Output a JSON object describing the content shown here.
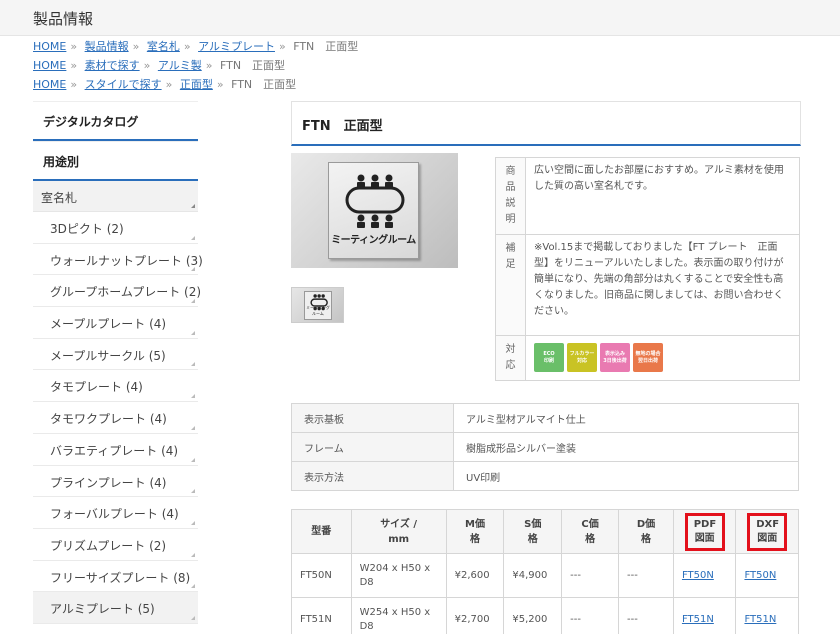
{
  "header": {
    "title": "製品情報"
  },
  "breadcrumbs": [
    {
      "links": [
        "HOME",
        "製品情報",
        "室名札",
        "アルミプレート"
      ],
      "current": "FTN　正面型"
    },
    {
      "links": [
        "HOME",
        "素材で探す",
        "アルミ製"
      ],
      "current": "FTN　正面型"
    },
    {
      "links": [
        "HOME",
        "スタイルで探す",
        "正面型"
      ],
      "current": "FTN　正面型"
    }
  ],
  "sidebar": {
    "catalog": "デジタルカタログ",
    "usage": "用途別",
    "category": "室名札",
    "items": [
      "3Dピクト (2)",
      "ウォールナットプレート (3)",
      "グループホームプレート (2)",
      "メープルプレート (4)",
      "メープルサークル (5)",
      "タモプレート (4)",
      "タモワクプレート (4)",
      "バラエティプレート (4)",
      "プラインプレート (4)",
      "フォーバルプレート (4)",
      "プリズムプレート (2)",
      "フリーサイズプレート (8)",
      "アルミプレート (5)"
    ]
  },
  "product": {
    "title": "FTN　正面型",
    "image_label": "ミーティングルーム",
    "description": {
      "k1": "商品説明",
      "v1": "広い空間に面したお部屋におすすめ。アルミ素材を使用した質の高い室名札です。",
      "k2": "補足",
      "v2": "※Vol.15まで掲載しておりました【FT プレート　正面型】をリニューアルいたしました。表示面の取り付けが簡単になり、先端の角部分は丸くすることで安全性も高くなりました。旧商品に関しましては、お問い合わせください。",
      "k3": "対応",
      "badges": [
        {
          "l1": "ECO",
          "l2": "印刷",
          "color": "#6abf69"
        },
        {
          "l1": "フルカラー",
          "l2": "対応",
          "color": "#c9c324"
        },
        {
          "l1": "表示込み",
          "l2": "3日後出荷",
          "color": "#e97ab1"
        },
        {
          "l1": "無地の場合",
          "l2": "翌日出荷",
          "color": "#e9784a"
        }
      ]
    },
    "specs": [
      {
        "k": "表示基板",
        "v": "アルミ型材アルマイト仕上"
      },
      {
        "k": "フレーム",
        "v": "樹脂成形品シルバー塗装"
      },
      {
        "k": "表示方法",
        "v": "UV印刷"
      }
    ],
    "price_table": {
      "headers": [
        "型番",
        "サイズ / mm",
        "M価格",
        "S価格",
        "C価格",
        "D価格",
        "PDF図面",
        "DXF図面"
      ],
      "rows": [
        {
          "model": "FT50N",
          "size": "W204 x H50 x D8",
          "m": "¥2,600",
          "s": "¥4,900",
          "c": "---",
          "d": "---",
          "pdf": "FT50N",
          "dxf": "FT50N"
        },
        {
          "model": "FT51N",
          "size": "W254 x H50 x D8",
          "m": "¥2,700",
          "s": "¥5,200",
          "c": "---",
          "d": "---",
          "pdf": "FT51N",
          "dxf": "FT51N"
        }
      ]
    }
  },
  "colors": {
    "accent": "#2a6ebb",
    "highlight": "#e3101b"
  }
}
